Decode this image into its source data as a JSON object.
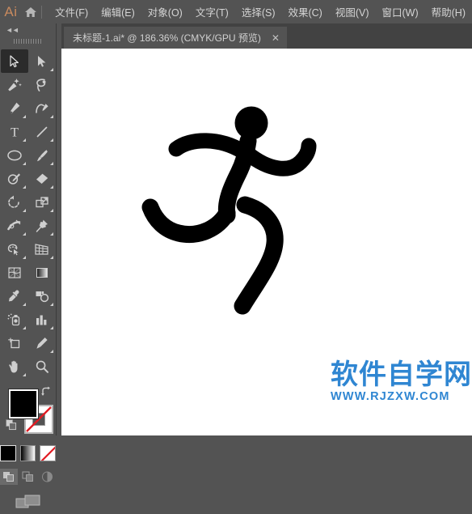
{
  "app": {
    "name": "Ai",
    "logo_color": "#c98a5e",
    "chrome_color": "#535353",
    "tabbar_color": "#424242"
  },
  "menubar": {
    "logo_label": "Ai",
    "home_icon": "home-icon",
    "items": [
      {
        "label": "文件(F)"
      },
      {
        "label": "编辑(E)"
      },
      {
        "label": "对象(O)"
      },
      {
        "label": "文字(T)"
      },
      {
        "label": "选择(S)"
      },
      {
        "label": "效果(C)"
      },
      {
        "label": "视图(V)"
      },
      {
        "label": "窗口(W)"
      },
      {
        "label": "帮助(H)"
      }
    ]
  },
  "tabbar": {
    "tabs": [
      {
        "title": "未标题-1.ai* @ 186.36% (CMYK/GPU 预览)",
        "close_label": "✕",
        "active": true
      }
    ]
  },
  "toolpanel": {
    "collapse_label": "◄◄",
    "tools": [
      {
        "name": "selection-tool",
        "label": "选择工具",
        "active": true,
        "has_flyout": false
      },
      {
        "name": "direct-selection-tool",
        "label": "直接选择工具",
        "active": false,
        "has_flyout": true
      },
      {
        "name": "magic-wand-tool",
        "label": "魔棒工具",
        "active": false,
        "has_flyout": false
      },
      {
        "name": "lasso-tool",
        "label": "套索工具",
        "active": false,
        "has_flyout": false
      },
      {
        "name": "pen-tool",
        "label": "钢笔工具",
        "active": false,
        "has_flyout": true
      },
      {
        "name": "curvature-tool",
        "label": "曲率工具",
        "active": false,
        "has_flyout": true
      },
      {
        "name": "type-tool",
        "label": "文字工具",
        "active": false,
        "has_flyout": true
      },
      {
        "name": "line-segment-tool",
        "label": "直线段工具",
        "active": false,
        "has_flyout": true
      },
      {
        "name": "ellipse-tool",
        "label": "椭圆工具",
        "active": false,
        "has_flyout": true
      },
      {
        "name": "paintbrush-tool",
        "label": "画笔工具",
        "active": false,
        "has_flyout": true
      },
      {
        "name": "shaper-tool",
        "label": "Shaper 工具",
        "active": false,
        "has_flyout": true
      },
      {
        "name": "eraser-tool",
        "label": "橡皮擦工具",
        "active": false,
        "has_flyout": true
      },
      {
        "name": "rotate-tool",
        "label": "旋转工具",
        "active": false,
        "has_flyout": true
      },
      {
        "name": "scale-tool",
        "label": "比例缩放工具",
        "active": false,
        "has_flyout": true
      },
      {
        "name": "width-tool",
        "label": "宽度工具",
        "active": false,
        "has_flyout": true
      },
      {
        "name": "free-transform-tool",
        "label": "自由变换工具",
        "active": false,
        "has_flyout": true
      },
      {
        "name": "shape-builder-tool",
        "label": "形状生成器工具",
        "active": false,
        "has_flyout": true
      },
      {
        "name": "perspective-grid-tool",
        "label": "透视网格工具",
        "active": false,
        "has_flyout": true
      },
      {
        "name": "mesh-tool",
        "label": "网格工具",
        "active": false,
        "has_flyout": false
      },
      {
        "name": "gradient-tool",
        "label": "渐变工具",
        "active": false,
        "has_flyout": false
      },
      {
        "name": "eyedropper-tool",
        "label": "吸管工具",
        "active": false,
        "has_flyout": true
      },
      {
        "name": "blend-tool",
        "label": "混合工具",
        "active": false,
        "has_flyout": true
      },
      {
        "name": "symbol-sprayer-tool",
        "label": "符号喷枪工具",
        "active": false,
        "has_flyout": true
      },
      {
        "name": "column-graph-tool",
        "label": "柱形图工具",
        "active": false,
        "has_flyout": true
      },
      {
        "name": "artboard-tool",
        "label": "画板工具",
        "active": false,
        "has_flyout": false
      },
      {
        "name": "slice-tool",
        "label": "切片工具",
        "active": false,
        "has_flyout": true
      },
      {
        "name": "hand-tool",
        "label": "抓手工具",
        "active": false,
        "has_flyout": true
      },
      {
        "name": "zoom-tool",
        "label": "缩放工具",
        "active": false,
        "has_flyout": false
      }
    ],
    "color_controls": {
      "fill_color": "#000000",
      "stroke_color": "#ffffff",
      "fill_label": "填色",
      "stroke_label": "描边",
      "swap_label": "互换填色和描边",
      "default_label": "默认填色和描边"
    },
    "paint_modes": [
      {
        "name": "color-mode",
        "label": "颜色",
        "selected": true
      },
      {
        "name": "gradient-mode",
        "label": "渐变",
        "selected": false
      },
      {
        "name": "none-mode",
        "label": "无",
        "selected": false
      }
    ],
    "drawing_modes": [
      {
        "name": "draw-normal",
        "label": "正常绘图",
        "selected": true
      },
      {
        "name": "draw-behind",
        "label": "背面绘图",
        "selected": false
      },
      {
        "name": "draw-inside",
        "label": "内部绘图",
        "selected": false
      }
    ],
    "screen_mode": {
      "name": "screen-mode",
      "label": "更改屏幕模式"
    }
  },
  "canvas": {
    "background": "#ffffff",
    "zoom_level": "186.36%",
    "artwork_name": "足球运动员剪影",
    "artwork_color": "#000000"
  },
  "watermark": {
    "chinese": "软件自学网",
    "url": "WWW.RJZXW.COM",
    "color": "#2f86d2"
  }
}
